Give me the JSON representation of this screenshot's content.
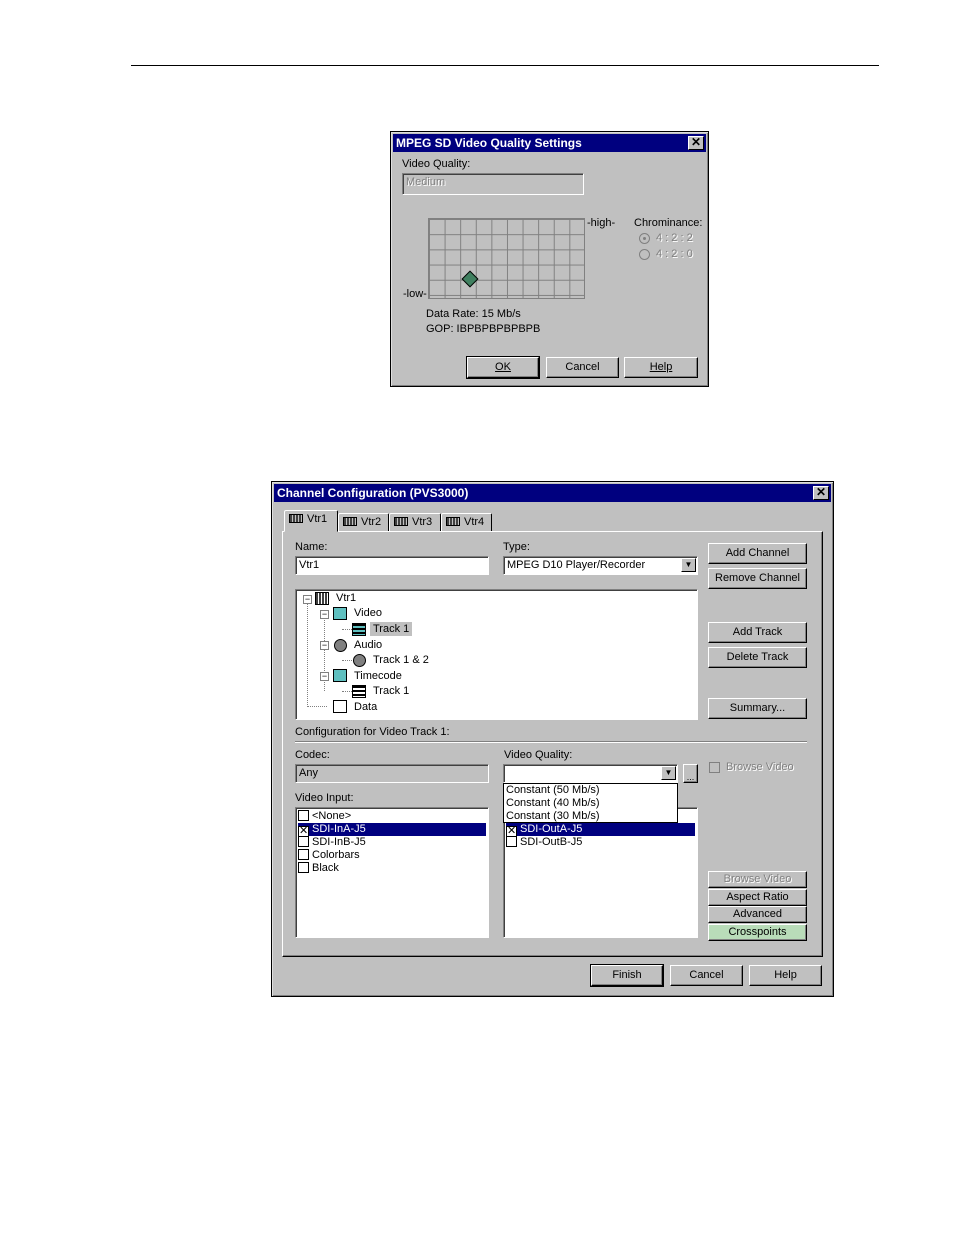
{
  "dialog1": {
    "title": "MPEG SD Video Quality Settings",
    "video_quality_label": "Video Quality:",
    "video_quality_value": "Medium",
    "high_label": "-high-",
    "low_label": "-low-",
    "chrominance_label": "Chrominance:",
    "chroma_options": [
      "4 : 2 : 2",
      "4 : 2 : 0"
    ],
    "chroma_selected_index": 0,
    "data_rate_text": "Data Rate:  15 Mb/s",
    "gop_text": "GOP:  IBPBPBPBPBPB",
    "ok_label": "OK",
    "cancel_label": "Cancel",
    "help_label": "Help"
  },
  "dialog2": {
    "title": "Channel Configuration (PVS3000)",
    "tabs": [
      "Vtr1",
      "Vtr2",
      "Vtr3",
      "Vtr4"
    ],
    "active_tab_index": 0,
    "name_label": "Name:",
    "name_value": "Vtr1",
    "type_label": "Type:",
    "type_value": "MPEG D10 Player/Recorder",
    "buttons": {
      "add_channel": "Add Channel",
      "remove_channel": "Remove Channel",
      "add_track": "Add Track",
      "delete_track": "Delete Track",
      "summary": "Summary...",
      "browse_video": "Browse Video",
      "aspect_ratio": "Aspect Ratio",
      "advanced": "Advanced",
      "crosspoints": "Crosspoints",
      "finish": "Finish",
      "cancel": "Cancel",
      "help": "Help"
    },
    "tree": {
      "root": "Vtr1",
      "video": "Video",
      "video_track": "Track 1",
      "audio": "Audio",
      "audio_track": "Track 1 & 2",
      "timecode": "Timecode",
      "timecode_track": "Track 1",
      "data": "Data"
    },
    "config_label": "Configuration for Video Track 1:",
    "codec_label": "Codec:",
    "codec_value": "Any",
    "video_quality_label": "Video Quality:",
    "video_quality_value": "",
    "quality_options": [
      "Constant (50 Mb/s)",
      "Constant (40 Mb/s)",
      "Constant (30 Mb/s)"
    ],
    "browse_video_check_label": "Browse Video",
    "video_input_label": "Video Input:",
    "video_inputs": [
      {
        "label": "<None>",
        "checked": false,
        "selected": false
      },
      {
        "label": "SDI-InA-J5",
        "checked": true,
        "selected": true
      },
      {
        "label": "SDI-InB-J5",
        "checked": false,
        "selected": false
      },
      {
        "label": "Colorbars",
        "checked": false,
        "selected": false
      },
      {
        "label": "Black",
        "checked": false,
        "selected": false
      }
    ],
    "video_outputs": [
      {
        "label": "SDI-OutA-J5",
        "checked": true,
        "selected": true
      },
      {
        "label": "SDI-OutB-J5",
        "checked": false,
        "selected": false
      }
    ]
  }
}
